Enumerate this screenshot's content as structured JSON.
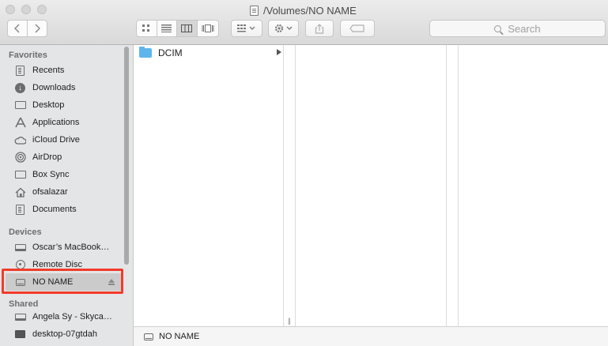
{
  "window": {
    "title": "/Volumes/NO NAME"
  },
  "toolbar": {
    "back_icon": "chevron-left-icon",
    "forward_icon": "chevron-right-icon",
    "view_modes": [
      "icon-view-icon",
      "list-view-icon",
      "column-view-icon",
      "cover-flow-icon"
    ],
    "active_view": "column-view-icon",
    "arrange_icon": "arrange-grid-icon",
    "action_icon": "gear-icon",
    "share_icon": "share-icon",
    "tag_icon": "tag-icon",
    "search_placeholder": "Search"
  },
  "sidebar": {
    "favorites_heading": "Favorites",
    "favorites": [
      {
        "label": "Recents",
        "icon": "recents-icon"
      },
      {
        "label": "Downloads",
        "icon": "downloads-icon"
      },
      {
        "label": "Desktop",
        "icon": "desktop-icon"
      },
      {
        "label": "Applications",
        "icon": "applications-icon"
      },
      {
        "label": "iCloud Drive",
        "icon": "cloud-icon"
      },
      {
        "label": "AirDrop",
        "icon": "airdrop-icon"
      },
      {
        "label": "Box Sync",
        "icon": "folder-icon"
      },
      {
        "label": "ofsalazar",
        "icon": "home-icon"
      },
      {
        "label": "Documents",
        "icon": "documents-icon"
      }
    ],
    "devices_heading": "Devices",
    "devices": [
      {
        "label": "Oscar’s MacBook…",
        "icon": "laptop-icon"
      },
      {
        "label": "Remote Disc",
        "icon": "disc-icon"
      },
      {
        "label": "NO NAME",
        "icon": "external-drive-icon",
        "selected": true
      }
    ],
    "shared_heading": "Shared",
    "shared": [
      {
        "label": "Angela Sy - Skyca…",
        "icon": "laptop-icon"
      },
      {
        "label": "desktop-07gtdah",
        "icon": "monitor-icon"
      }
    ]
  },
  "browser": {
    "column1": [
      {
        "name": "DCIM",
        "type": "folder"
      }
    ]
  },
  "pathbar": {
    "label": "NO NAME"
  },
  "colors": {
    "highlight": "#f23b2a",
    "folder": "#5eb5ec"
  }
}
